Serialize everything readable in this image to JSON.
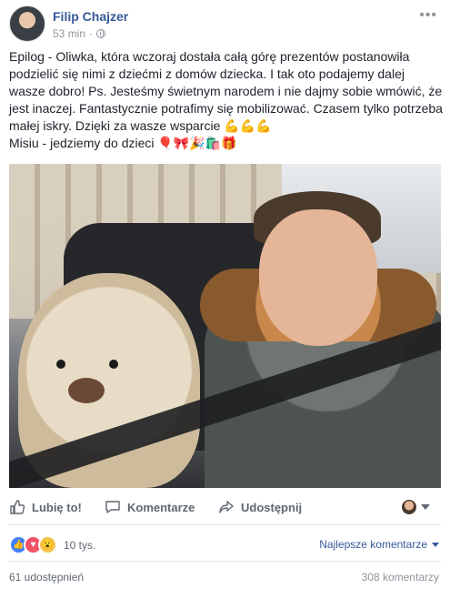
{
  "post": {
    "author": "Filip Chajzer",
    "time": "53 min",
    "dot": "·",
    "more": "•••",
    "text_lines": [
      "Epilog - Oliwka, która wczoraj dostała całą górę prezentów postanowiła podzielić się nimi z dziećmi z domów dziecka. I tak oto podajemy dalej wasze dobro! Ps. Jesteśmy świetnym narodem i nie dajmy sobie wmówić, że jest inaczej. Fantastycznie potrafimy się mobilizować. Czasem tylko potrzeba małej iskry. Dzięki za wasze wsparcie 💪💪💪",
      "Misiu - jedziemy do dzieci 🎈🎀🎉🛍️🎁"
    ]
  },
  "actions": {
    "like": "Lubię to!",
    "comment": "Komentarze",
    "share": "Udostępnij"
  },
  "reactions": {
    "count": "10 tys.",
    "like_icon": "like-icon",
    "love_icon": "love-icon",
    "wow_icon": "wow-icon"
  },
  "sort": {
    "label": "Najlepsze komentarze"
  },
  "footer": {
    "shares": "61 udostępnień",
    "comments": "308 komentarzy"
  },
  "colors": {
    "link": "#365899",
    "secondary_text": "#90949c",
    "like_blue": "#4080ff",
    "love_red": "#f25268"
  }
}
